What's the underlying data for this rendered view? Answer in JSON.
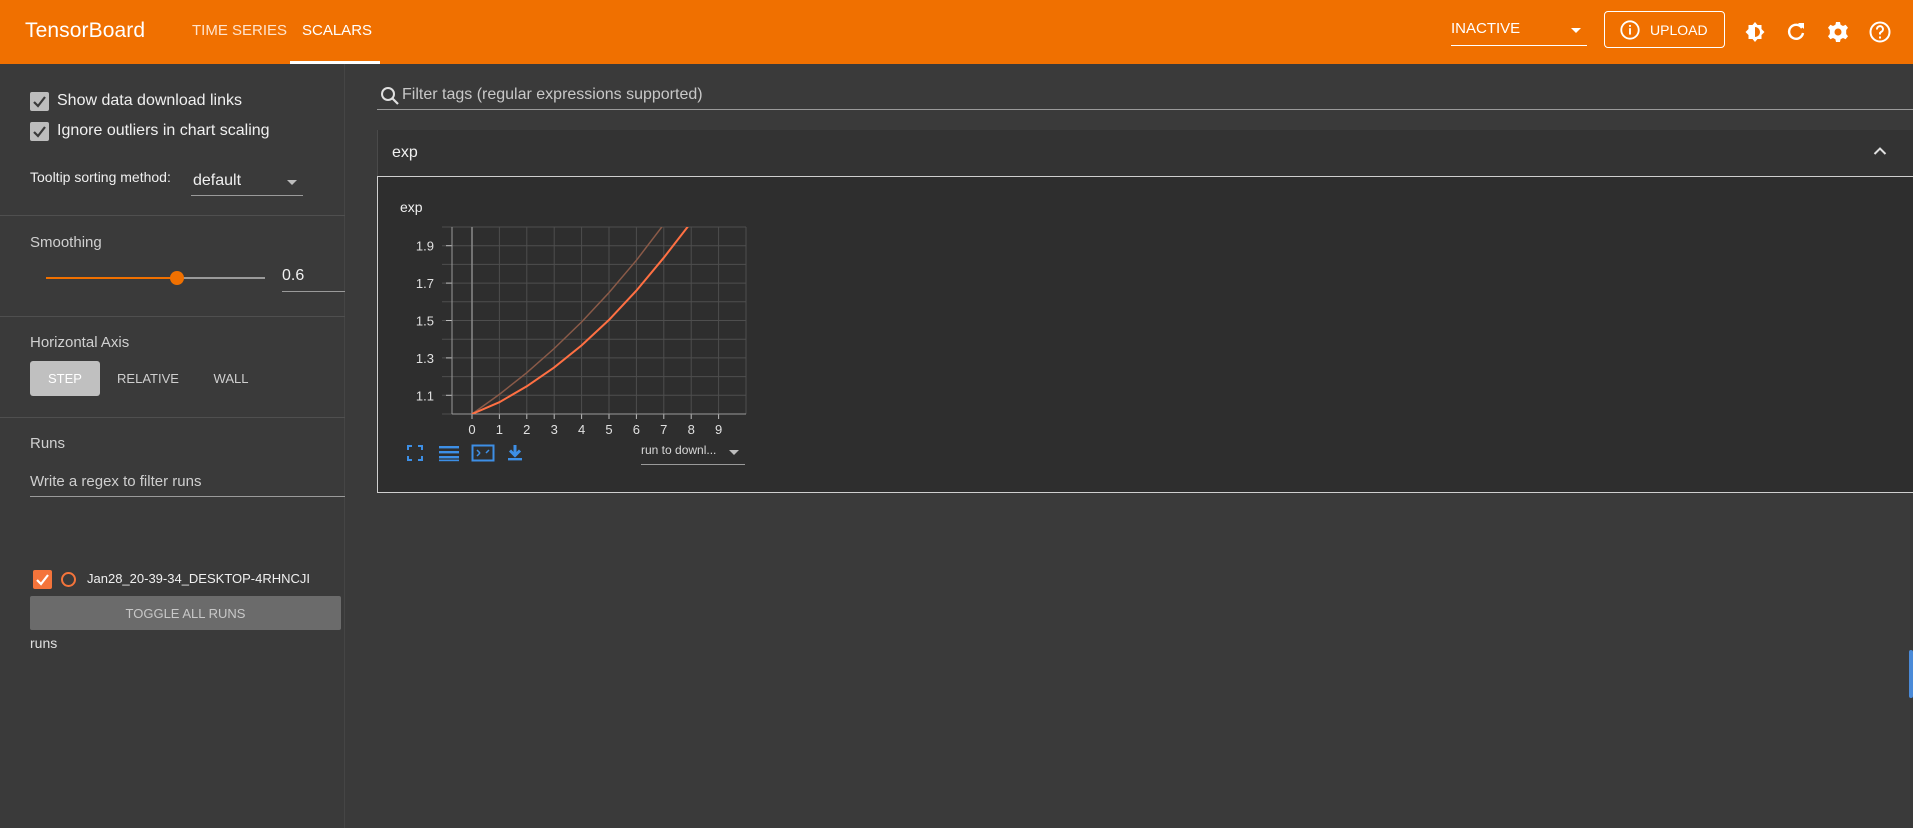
{
  "app": {
    "brand": "TensorBoard",
    "tabs": [
      {
        "label": "TIME SERIES"
      },
      {
        "label": "SCALARS"
      }
    ],
    "status_select": "INACTIVE",
    "upload_label": "UPLOAD",
    "accent_color": "#f07000"
  },
  "sidebar": {
    "show_download_links": "Show data download links",
    "ignore_outliers": "Ignore outliers in chart scaling",
    "tooltip_sort_label": "Tooltip sorting method:",
    "tooltip_sort_value": "default",
    "smoothing_label": "Smoothing",
    "smoothing_value": "0.6",
    "horizontal_axis_label": "Horizontal Axis",
    "axis_buttons": [
      {
        "label": "STEP"
      },
      {
        "label": "RELATIVE"
      },
      {
        "label": "WALL"
      }
    ],
    "runs_label": "Runs",
    "runs_filter_placeholder": "Write a regex to filter runs",
    "run_name": "Jan28_20-39-34_DESKTOP-4RHNCJI",
    "run_color": "#f4743b",
    "toggle_all_label": "TOGGLE ALL RUNS",
    "runs_footer": "runs"
  },
  "main": {
    "filter_placeholder": "Filter tags (regular expressions supported)",
    "group_title": "exp",
    "card_title": "exp",
    "download_select": "run to downl..."
  },
  "chart_data": {
    "type": "line",
    "title": "exp",
    "x_ticks": [
      "0",
      "1",
      "2",
      "3",
      "4",
      "5",
      "6",
      "7",
      "8",
      "9"
    ],
    "y_ticks": [
      "1.1",
      "1.3",
      "1.5",
      "1.7",
      "1.9"
    ],
    "xlim": [
      0,
      10
    ],
    "ylim": [
      1.0,
      2.0
    ],
    "grid": true,
    "series": [
      {
        "role": "raw",
        "color": "#8a5a48",
        "x": [
          0,
          1,
          2,
          3,
          4,
          5,
          6,
          7,
          7.3
        ],
        "values": [
          1.0,
          1.105,
          1.221,
          1.35,
          1.492,
          1.649,
          1.822,
          2.014,
          2.075
        ]
      },
      {
        "role": "smoothed",
        "color": "#ff7043",
        "x": [
          0,
          1,
          2,
          3,
          4,
          5,
          6,
          7,
          8,
          8.6
        ],
        "values": [
          1.0,
          1.063,
          1.148,
          1.249,
          1.367,
          1.503,
          1.66,
          1.836,
          2.025,
          2.06
        ]
      }
    ]
  }
}
